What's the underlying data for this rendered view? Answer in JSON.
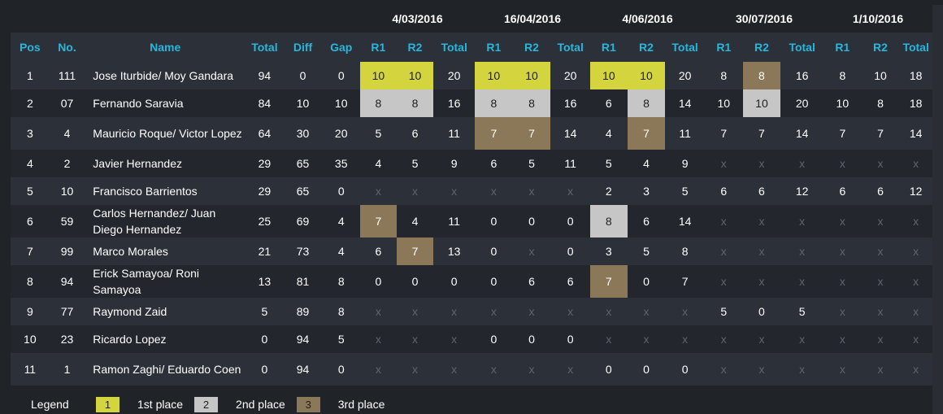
{
  "table": {
    "dates": [
      "4/03/2016",
      "16/04/2016",
      "4/06/2016",
      "30/07/2016",
      "1/10/2016"
    ],
    "headers": {
      "pos": "Pos",
      "no": "No.",
      "name": "Name",
      "total": "Total",
      "diff": "Diff",
      "gap": "Gap",
      "r1": "R1",
      "r2": "R2",
      "event_total": "Total"
    },
    "rows": [
      {
        "pos": "1",
        "no": "111",
        "name": "Jose Iturbide/ Moy Gandara",
        "total": "94",
        "diff": "0",
        "gap": "0",
        "cells": [
          "10",
          "10",
          "20",
          "10",
          "10",
          "20",
          "10",
          "10",
          "20",
          "8",
          "8",
          "16",
          "8",
          "10",
          "18"
        ],
        "places": [
          "gold",
          "gold",
          "",
          "gold",
          "gold",
          "",
          "gold",
          "gold",
          "",
          "",
          "bronze",
          "",
          "",
          "",
          ""
        ]
      },
      {
        "pos": "2",
        "no": "07",
        "name": "Fernando Saravia",
        "total": "84",
        "diff": "10",
        "gap": "10",
        "cells": [
          "8",
          "8",
          "16",
          "8",
          "8",
          "16",
          "6",
          "8",
          "14",
          "10",
          "10",
          "20",
          "10",
          "8",
          "18"
        ],
        "places": [
          "silver",
          "silver",
          "",
          "silver",
          "silver",
          "",
          "",
          "silver",
          "",
          "",
          "silver",
          "",
          "",
          "",
          ""
        ]
      },
      {
        "pos": "3",
        "no": "4",
        "name": "Mauricio Roque/ Victor Lopez",
        "total": "64",
        "diff": "30",
        "gap": "20",
        "cells": [
          "5",
          "6",
          "11",
          "7",
          "7",
          "14",
          "4",
          "7",
          "11",
          "7",
          "7",
          "14",
          "7",
          "7",
          "14"
        ],
        "places": [
          "",
          "",
          "",
          "bronze",
          "bronze",
          "",
          "",
          "bronze",
          "",
          "",
          "",
          "",
          "",
          "",
          ""
        ]
      },
      {
        "pos": "4",
        "no": "2",
        "name": "Javier Hernandez",
        "total": "29",
        "diff": "65",
        "gap": "35",
        "cells": [
          "4",
          "5",
          "9",
          "6",
          "5",
          "11",
          "5",
          "4",
          "9",
          "x",
          "x",
          "x",
          "x",
          "x",
          "x"
        ],
        "places": [
          "",
          "",
          "",
          "",
          "",
          "",
          "",
          "",
          "",
          "",
          "",
          "",
          "",
          "",
          ""
        ]
      },
      {
        "pos": "5",
        "no": "10",
        "name": "Francisco Barrientos",
        "total": "29",
        "diff": "65",
        "gap": "0",
        "cells": [
          "x",
          "x",
          "x",
          "x",
          "x",
          "x",
          "2",
          "3",
          "5",
          "6",
          "6",
          "12",
          "6",
          "6",
          "12"
        ],
        "places": [
          "",
          "",
          "",
          "",
          "",
          "",
          "",
          "",
          "",
          "",
          "",
          "",
          "",
          "",
          ""
        ]
      },
      {
        "pos": "6",
        "no": "59",
        "name": "Carlos Hernandez/ Juan Diego Hernandez",
        "total": "25",
        "diff": "69",
        "gap": "4",
        "cells": [
          "7",
          "4",
          "11",
          "0",
          "0",
          "0",
          "8",
          "6",
          "14",
          "x",
          "x",
          "x",
          "x",
          "x",
          "x"
        ],
        "places": [
          "bronze",
          "",
          "",
          "",
          "",
          "",
          "silver",
          "",
          "",
          "",
          "",
          "",
          "",
          "",
          ""
        ]
      },
      {
        "pos": "7",
        "no": "99",
        "name": "Marco Morales",
        "total": "21",
        "diff": "73",
        "gap": "4",
        "cells": [
          "6",
          "7",
          "13",
          "0",
          "x",
          "0",
          "3",
          "5",
          "8",
          "x",
          "x",
          "x",
          "x",
          "x",
          "x"
        ],
        "places": [
          "",
          "bronze",
          "",
          "",
          "",
          "",
          "",
          "",
          "",
          "",
          "",
          "",
          "",
          "",
          ""
        ]
      },
      {
        "pos": "8",
        "no": "94",
        "name": "Erick Samayoa/ Roni Samayoa",
        "total": "13",
        "diff": "81",
        "gap": "8",
        "cells": [
          "0",
          "0",
          "0",
          "0",
          "6",
          "6",
          "7",
          "0",
          "7",
          "x",
          "x",
          "x",
          "x",
          "x",
          "x"
        ],
        "places": [
          "",
          "",
          "",
          "",
          "",
          "",
          "bronze",
          "",
          "",
          "",
          "",
          "",
          "",
          "",
          ""
        ]
      },
      {
        "pos": "9",
        "no": "77",
        "name": "Raymond Zaid",
        "total": "5",
        "diff": "89",
        "gap": "8",
        "cells": [
          "x",
          "x",
          "x",
          "x",
          "x",
          "x",
          "x",
          "x",
          "x",
          "5",
          "0",
          "5",
          "x",
          "x",
          "x"
        ],
        "places": [
          "",
          "",
          "",
          "",
          "",
          "",
          "",
          "",
          "",
          "",
          "",
          "",
          "",
          "",
          ""
        ]
      },
      {
        "pos": "10",
        "no": "23",
        "name": "Ricardo Lopez",
        "total": "0",
        "diff": "94",
        "gap": "5",
        "cells": [
          "x",
          "x",
          "x",
          "0",
          "0",
          "0",
          "x",
          "x",
          "x",
          "x",
          "x",
          "x",
          "x",
          "x",
          "x"
        ],
        "places": [
          "",
          "",
          "",
          "",
          "",
          "",
          "",
          "",
          "",
          "",
          "",
          "",
          "",
          "",
          ""
        ]
      },
      {
        "pos": "11",
        "no": "1",
        "name": "Ramon Zaghi/ Eduardo Coen",
        "total": "0",
        "diff": "94",
        "gap": "0",
        "cells": [
          "x",
          "x",
          "x",
          "x",
          "x",
          "x",
          "0",
          "0",
          "0",
          "x",
          "x",
          "x",
          "x",
          "x",
          "x"
        ],
        "places": [
          "",
          "",
          "",
          "",
          "",
          "",
          "",
          "",
          "",
          "",
          "",
          "",
          "",
          "",
          ""
        ]
      }
    ]
  },
  "legend": {
    "label": "Legend",
    "items": [
      {
        "swatch": "1",
        "text": "1st place",
        "color": "#d4d53e"
      },
      {
        "swatch": "2",
        "text": "2nd place",
        "color": "#c6c6c6"
      },
      {
        "swatch": "3",
        "text": "3rd place",
        "color": "#8a7858"
      }
    ]
  },
  "colors": {
    "accent": "#29b6dc",
    "background": "#202328",
    "gold": "#d4d53e",
    "silver": "#c6c6c6",
    "bronze": "#8a7858"
  }
}
